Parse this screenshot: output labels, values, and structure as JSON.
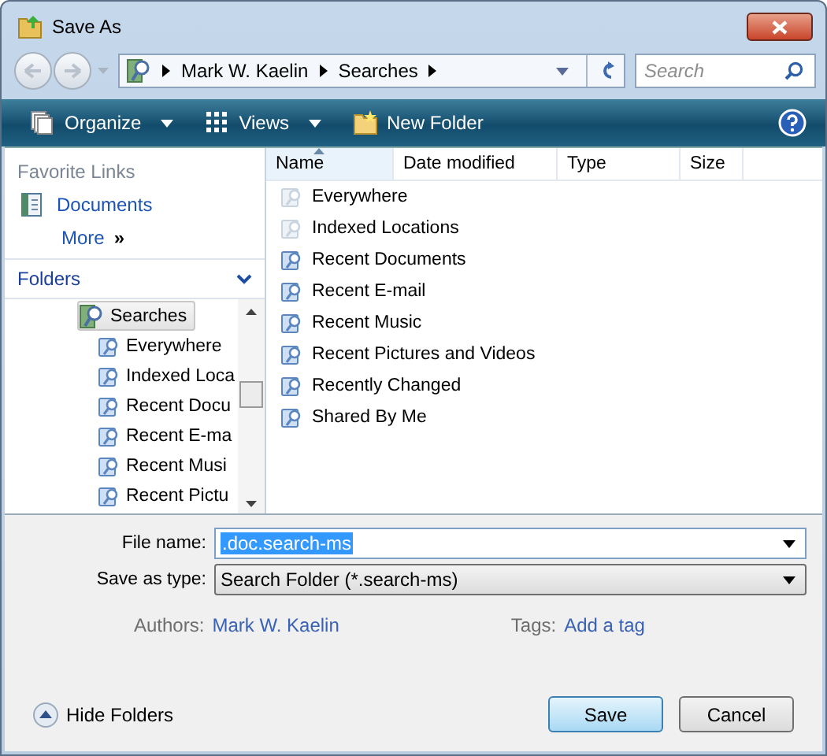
{
  "window": {
    "title": "Save As"
  },
  "address_bar": {
    "crumbs": [
      "Mark W. Kaelin",
      "Searches"
    ]
  },
  "search": {
    "placeholder": "Search"
  },
  "toolbar": {
    "items": [
      {
        "label": "Organize",
        "kind": "menu"
      },
      {
        "label": "Views",
        "kind": "menu"
      },
      {
        "label": "New Folder",
        "kind": "folder"
      }
    ]
  },
  "favorite_links": {
    "title": "Favorite Links",
    "items": [
      "Documents"
    ],
    "more": "More",
    "more_glyph": "»"
  },
  "folders": {
    "title": "Folders",
    "tree": [
      {
        "label": "Searches",
        "selected": true,
        "children": [
          {
            "label": "Everywhere",
            "selected": false
          },
          {
            "label": "Indexed Loca",
            "selected": false
          },
          {
            "label": "Recent Docu",
            "selected": false
          },
          {
            "label": "Recent E-ma",
            "selected": false
          },
          {
            "label": "Recent Musi",
            "selected": false
          },
          {
            "label": "Recent Pictu",
            "selected": false
          }
        ]
      }
    ]
  },
  "file_list": {
    "columns": [
      {
        "label": "Name",
        "sorted": true
      },
      {
        "label": "Date modified",
        "sorted": false
      },
      {
        "label": "Type",
        "sorted": false
      },
      {
        "label": "Size",
        "sorted": false
      }
    ],
    "items": [
      {
        "name": "Everywhere",
        "faded": true
      },
      {
        "name": "Indexed Locations",
        "faded": true
      },
      {
        "name": "Recent Documents",
        "faded": false
      },
      {
        "name": "Recent E-mail",
        "faded": false
      },
      {
        "name": "Recent Music",
        "faded": false
      },
      {
        "name": "Recent Pictures and Videos",
        "faded": false
      },
      {
        "name": "Recently Changed",
        "faded": false
      },
      {
        "name": "Shared By Me",
        "faded": false
      }
    ]
  },
  "file_name": {
    "label": "File name:",
    "value": ".doc.search-ms"
  },
  "save_as_type": {
    "label": "Save as type:",
    "value": "Search Folder (*.search-ms)"
  },
  "authors": {
    "label": "Authors:",
    "value": "Mark W. Kaelin"
  },
  "tags": {
    "label": "Tags:",
    "value": "Add a tag"
  },
  "hide_folders": "Hide Folders",
  "buttons": [
    {
      "label": "Save",
      "default": true
    },
    {
      "label": "Cancel",
      "default": false
    }
  ]
}
